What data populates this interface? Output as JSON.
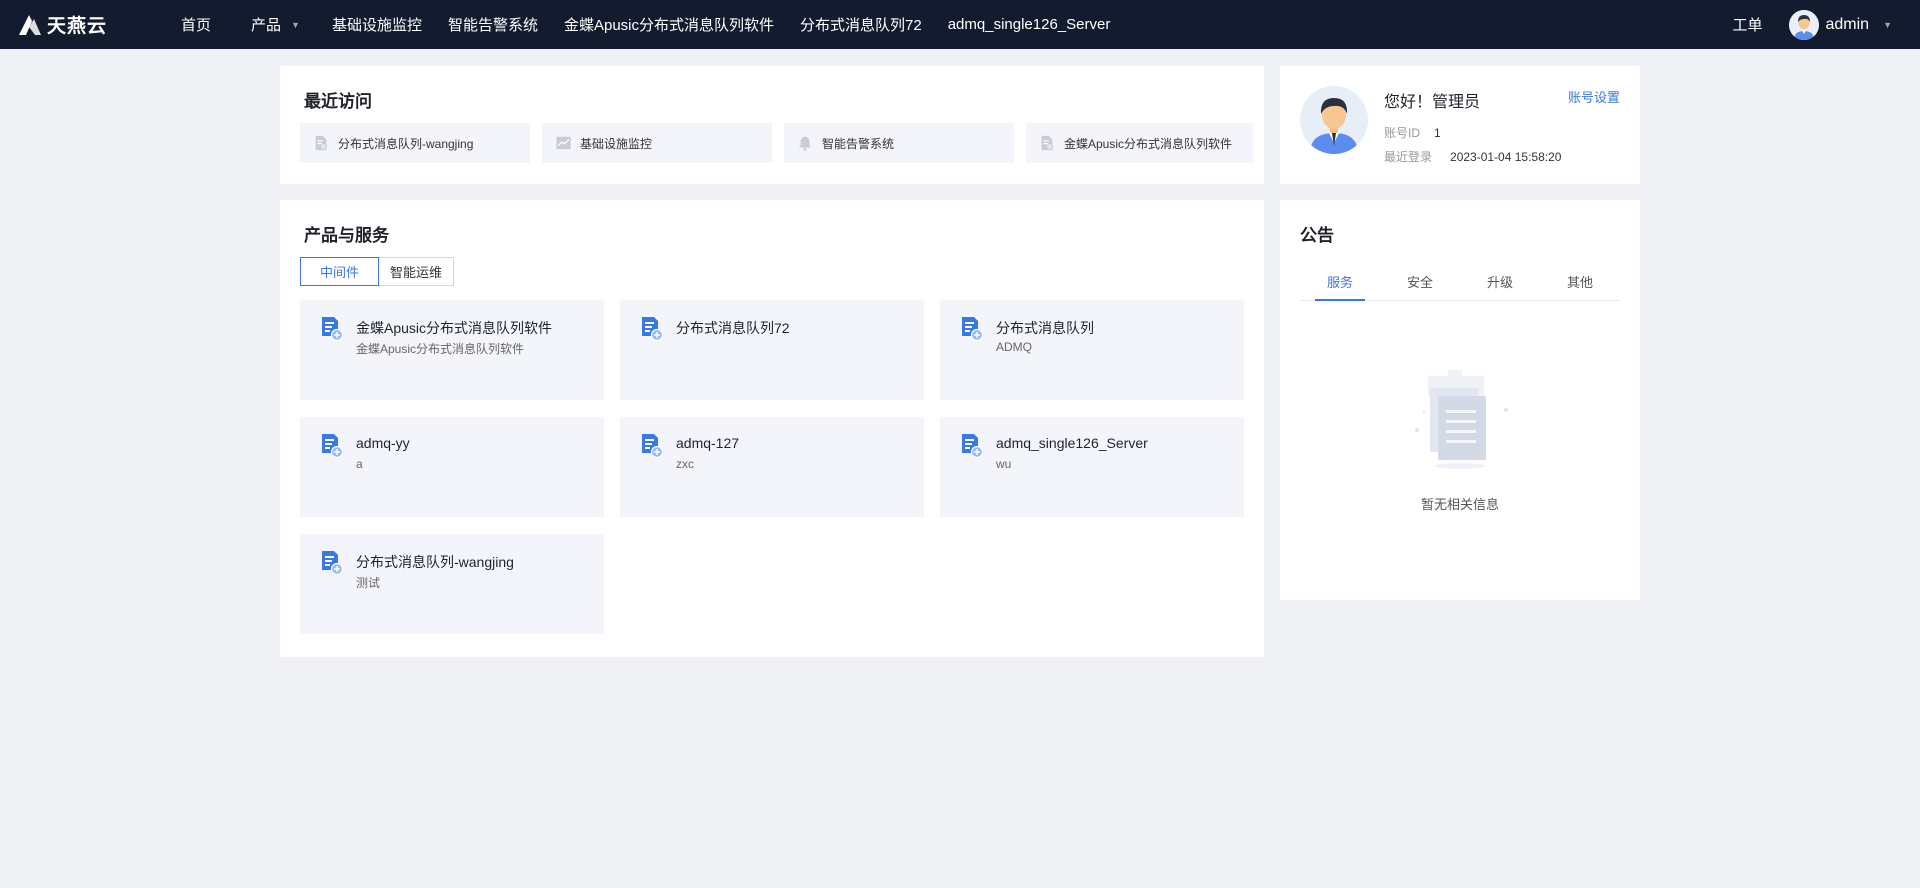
{
  "brand": {
    "name": "天燕云"
  },
  "nav": {
    "items": [
      {
        "label": "首页"
      },
      {
        "label": "产品"
      },
      {
        "label": "基础设施监控"
      },
      {
        "label": "智能告警系统"
      },
      {
        "label": "金蝶Apusic分布式消息队列软件"
      },
      {
        "label": "分布式消息队列72"
      },
      {
        "label": "admq_single126_Server"
      }
    ],
    "ticket": "工单",
    "user": "admin"
  },
  "recent": {
    "title": "最近访问",
    "items": [
      {
        "label": "分布式消息队列-wangjing",
        "icon": "file-icon"
      },
      {
        "label": "基础设施监控",
        "icon": "chart-icon"
      },
      {
        "label": "智能告警系统",
        "icon": "bell-icon"
      },
      {
        "label": "金蝶Apusic分布式消息队列软件",
        "icon": "file-icon"
      }
    ]
  },
  "products": {
    "title": "产品与服务",
    "tabs": [
      "中间件",
      "智能运维"
    ],
    "active_tab": "中间件",
    "cards": [
      {
        "name": "金蝶Apusic分布式消息队列软件",
        "desc": "金蝶Apusic分布式消息队列软件"
      },
      {
        "name": "分布式消息队列72",
        "desc": ""
      },
      {
        "name": "分布式消息队列",
        "desc": "ADMQ"
      },
      {
        "name": "admq-yy",
        "desc": "a"
      },
      {
        "name": "admq-127",
        "desc": "zxc"
      },
      {
        "name": "admq_single126_Server",
        "desc": "wu"
      },
      {
        "name": "分布式消息队列-wangjing",
        "desc": "测试"
      }
    ]
  },
  "profile": {
    "greeting": "您好！管理员",
    "settings_link": "账号设置",
    "account_id_label": "账号ID",
    "account_id": "1",
    "last_login_label": "最近登录",
    "last_login": "2023-01-04 15:58:20"
  },
  "notice": {
    "title": "公告",
    "tabs": [
      "服务",
      "安全",
      "升级",
      "其他"
    ],
    "active_tab": "服务",
    "empty_text": "暂无相关信息"
  },
  "colors": {
    "topbar": "#131b2e",
    "accent": "#3a78e7",
    "page_bg": "#eff1f5",
    "card_bg": "#f3f5fa"
  }
}
